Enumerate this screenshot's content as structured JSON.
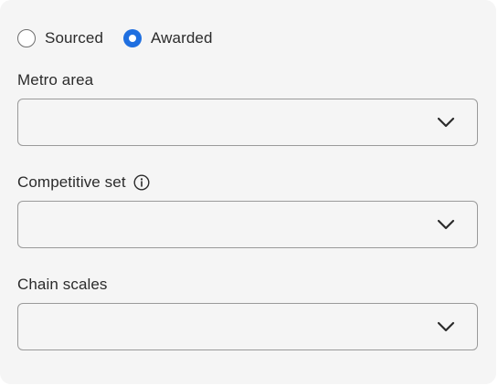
{
  "radio_group": {
    "options": [
      {
        "label": "Sourced",
        "checked": false
      },
      {
        "label": "Awarded",
        "checked": true
      }
    ]
  },
  "fields": [
    {
      "label": "Metro area",
      "value": "",
      "icon": "chevron-down-icon"
    },
    {
      "label": "Competitive set",
      "value": "",
      "info_icon": "info-icon",
      "icon": "chevron-down-icon"
    },
    {
      "label": "Chain scales",
      "value": "",
      "icon": "chevron-down-icon"
    }
  ],
  "colors": {
    "accent": "#1f6fe0",
    "panel_bg": "#f5f5f5",
    "border": "#9a9a9a",
    "text": "#2b2b2b"
  }
}
